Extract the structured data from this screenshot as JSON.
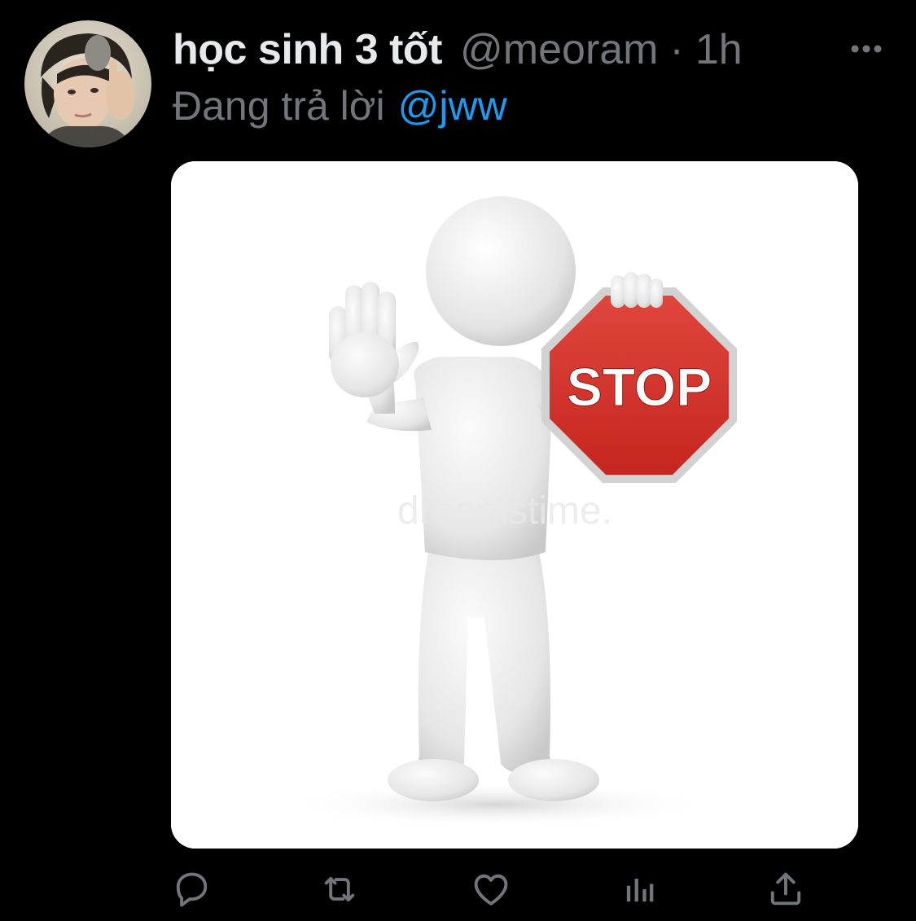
{
  "tweet": {
    "display_name": "học sinh 3 tốt",
    "handle": "@meoram",
    "separator": "·",
    "time": "1h",
    "reply_prefix": "Đang trả lời",
    "reply_mention": "@jww"
  },
  "media": {
    "sign_text": "STOP",
    "watermark": "dreamstime."
  },
  "icons": {
    "more": "more-horizontal-icon",
    "reply": "reply-icon",
    "retweet": "retweet-icon",
    "like": "heart-icon",
    "views": "analytics-icon",
    "share": "share-icon"
  },
  "colors": {
    "background": "#000000",
    "primary_text": "#e7e9ea",
    "secondary_text": "#71767b",
    "link": "#1d9bf0",
    "stop_red": "#d9322b"
  }
}
